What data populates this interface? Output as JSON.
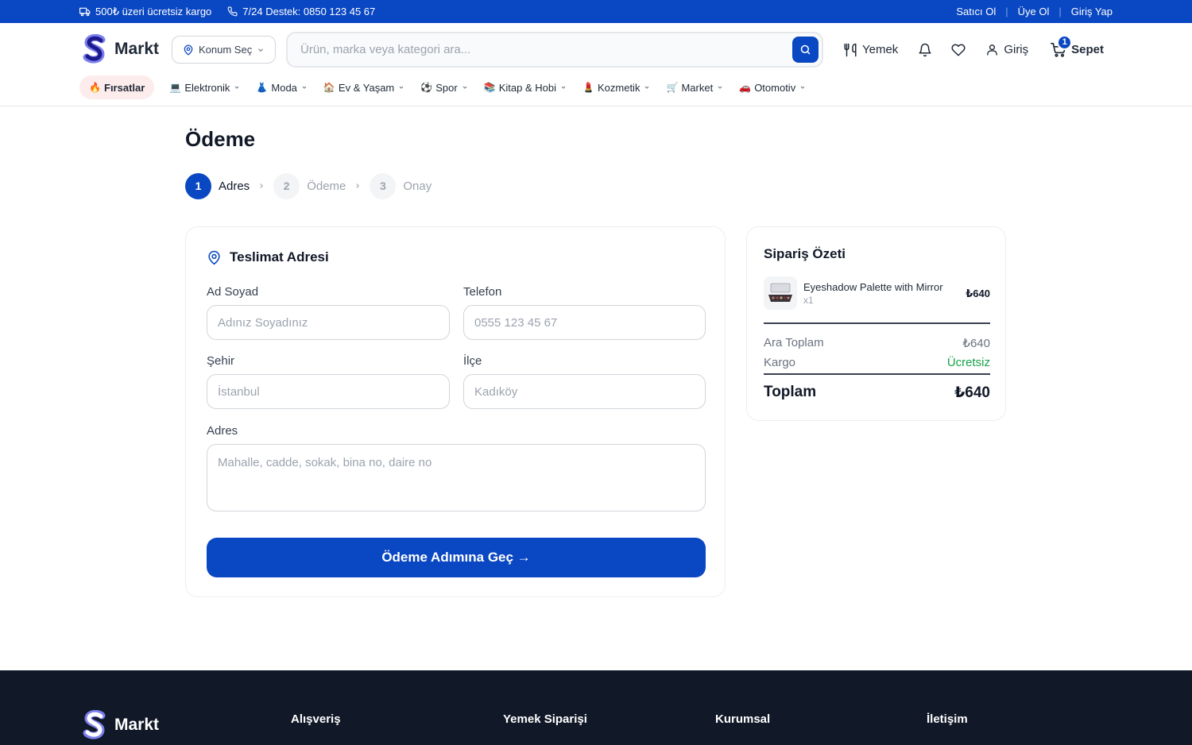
{
  "topbar": {
    "shipping": "500₺ üzeri ücretsiz kargo",
    "support": "7/24 Destek: 0850 123 45 67",
    "seller": "Satıcı Ol",
    "signup": "Üye Ol",
    "login": "Giriş Yap",
    "separator": "|"
  },
  "header": {
    "logo_text": "Markt",
    "location": "Konum Seç",
    "search_placeholder": "Ürün, marka veya kategori ara...",
    "food": "Yemek",
    "login": "Giriş",
    "cart_label": "Sepet",
    "cart_count": "1"
  },
  "categories": [
    {
      "emoji": "🔥",
      "label": "Fırsatlar"
    },
    {
      "emoji": "💻",
      "label": "Elektronik"
    },
    {
      "emoji": "👗",
      "label": "Moda"
    },
    {
      "emoji": "🏠",
      "label": "Ev & Yaşam"
    },
    {
      "emoji": "⚽",
      "label": "Spor"
    },
    {
      "emoji": "📚",
      "label": "Kitap & Hobi"
    },
    {
      "emoji": "💄",
      "label": "Kozmetik"
    },
    {
      "emoji": "🛒",
      "label": "Market"
    },
    {
      "emoji": "🚗",
      "label": "Otomotiv"
    }
  ],
  "page": {
    "title": "Ödeme",
    "steps": [
      {
        "num": "1",
        "label": "Adres"
      },
      {
        "num": "2",
        "label": "Ödeme"
      },
      {
        "num": "3",
        "label": "Onay"
      }
    ]
  },
  "address_form": {
    "title": "Teslimat Adresi",
    "name_label": "Ad Soyad",
    "name_placeholder": "Adınız Soyadınız",
    "phone_label": "Telefon",
    "phone_placeholder": "0555 123 45 67",
    "city_label": "Şehir",
    "city_placeholder": "İstanbul",
    "district_label": "İlçe",
    "district_placeholder": "Kadıköy",
    "address_label": "Adres",
    "address_placeholder": "Mahalle, cadde, sokak, bina no, daire no",
    "submit": "Ödeme Adımına Geç →"
  },
  "summary": {
    "title": "Sipariş Özeti",
    "item_name": "Eyeshadow Palette with Mirror",
    "item_qty": "x1",
    "item_price": "₺640",
    "subtotal_label": "Ara Toplam",
    "subtotal_value": "₺640",
    "shipping_label": "Kargo",
    "shipping_value": "Ücretsiz",
    "total_label": "Toplam",
    "total_value": "₺640"
  },
  "footer": {
    "logo_text": "Markt",
    "columns": [
      "Alışveriş",
      "Yemek Siparişi",
      "Kurumsal",
      "İletişim"
    ]
  },
  "colors": {
    "primary": "#0a47c2",
    "success": "#16a34a",
    "footer_bg": "#111827"
  }
}
